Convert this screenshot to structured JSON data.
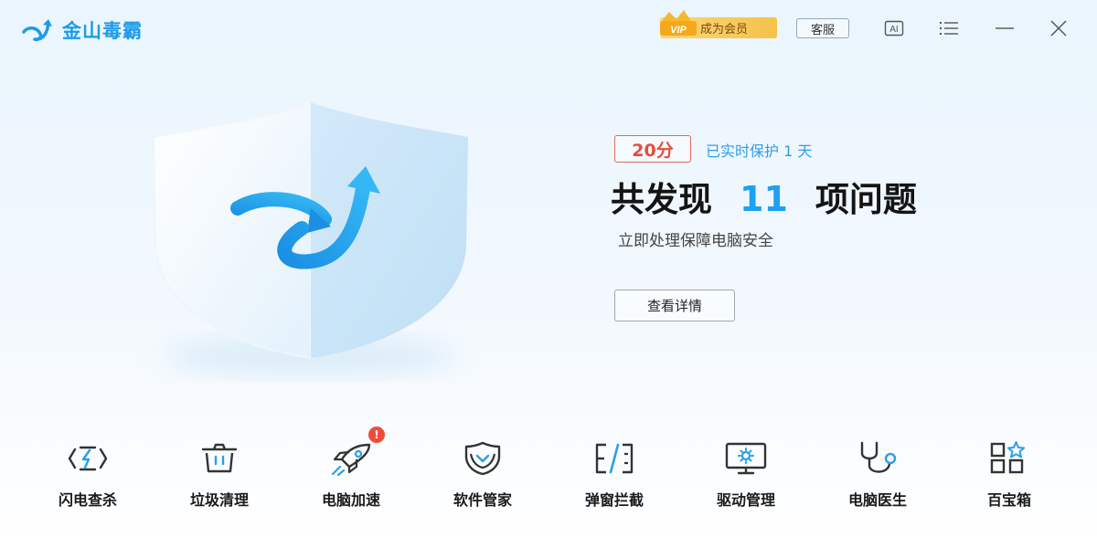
{
  "app": {
    "title": "金山毒霸"
  },
  "titlebar": {
    "vip_badge": "VIP",
    "vip_label": "成为会员",
    "service_label": "客服",
    "ai_label": "AI"
  },
  "hero": {
    "score": "20分",
    "protect_status": "已实时保护 1 天",
    "headline_prefix": "共发现",
    "issue_count": "11",
    "headline_suffix": "项问题",
    "subtitle": "立即处理保障电脑安全",
    "detail_button": "查看详情"
  },
  "tools": [
    {
      "label": "闪电查杀",
      "icon": "lightning-scan-icon"
    },
    {
      "label": "垃圾清理",
      "icon": "trash-bin-icon"
    },
    {
      "label": "电脑加速",
      "icon": "rocket-icon",
      "alert": "!"
    },
    {
      "label": "软件管家",
      "icon": "software-shield-icon"
    },
    {
      "label": "弹窗拦截",
      "icon": "popup-block-icon"
    },
    {
      "label": "驱动管理",
      "icon": "driver-monitor-icon"
    },
    {
      "label": "电脑医生",
      "icon": "stethoscope-icon"
    },
    {
      "label": "百宝箱",
      "icon": "toolbox-grid-icon"
    }
  ],
  "colors": {
    "brand": "#1c9be9",
    "accent_blue": "#1da1f2",
    "score_red": "#e0503b",
    "vip_gold": "#f5c24a",
    "alert_red": "#f04b3a"
  }
}
